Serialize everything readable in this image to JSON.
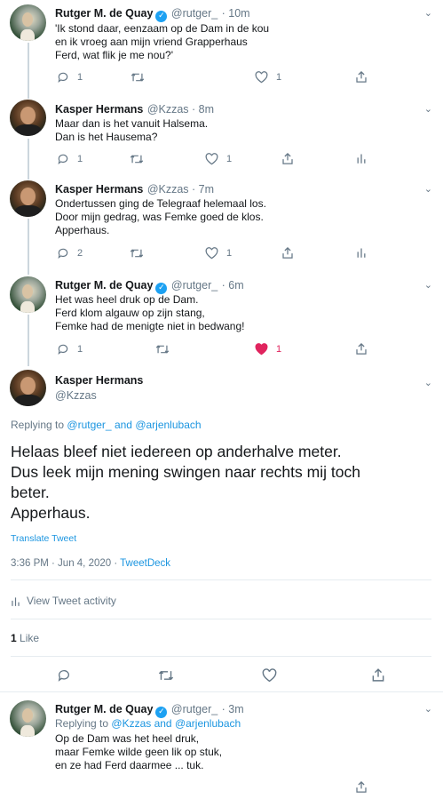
{
  "tweets": [
    {
      "name": "Rutger M. de Quay",
      "verified": true,
      "handle": "@rutger_",
      "time": "· 10m",
      "text": "'Ik stond daar, eenzaam op de Dam in de kou\nen ik vroeg aan mijn vriend Grapperhaus\nFerd, wat flik je me nou?'",
      "replies": "1",
      "retweets": "",
      "likes": "1",
      "avatar": "rutger"
    },
    {
      "name": "Kasper Hermans",
      "verified": false,
      "handle": "@Kzzas · 8m",
      "time": "",
      "text": "Maar dan is het vanuit Halsema.\nDan is het Hausema?",
      "replies": "1",
      "retweets": "",
      "likes": "1",
      "avatar": "kasper"
    },
    {
      "name": "Kasper Hermans",
      "verified": false,
      "handle": "@Kzzas · 7m",
      "time": "",
      "text": "Ondertussen ging de Telegraaf helemaal los.\nDoor mijn gedrag, was Femke goed de klos.\nApperhaus.",
      "replies": "2",
      "retweets": "",
      "likes": "1",
      "avatar": "kasper"
    },
    {
      "name": "Rutger M. de Quay",
      "verified": true,
      "handle": "@rutger_",
      "time": "· 6m",
      "text": "Het was heel druk op de Dam.\nFerd klom algauw op zijn stang,\nFemke had de menigte niet in bedwang!",
      "replies": "1",
      "retweets": "",
      "likes": "1",
      "avatar": "rutger"
    }
  ],
  "main_tweet": {
    "name": "Kasper Hermans",
    "handle": "@Kzzas",
    "replying_prefix": "Replying to",
    "replying_user1": "@rutger_",
    "replying_and": "and",
    "replying_user2": "@arjenlubach",
    "text": "Helaas bleef niet iedereen op anderhalve meter.\nDus leek mijn mening swingen naar rechts mij toch\nbeter.\nApperhaus.",
    "translate": "Translate Tweet",
    "timestamp": "3:36 PM · Jun 4, 2020 · ",
    "client": "TweetDeck",
    "activity": "View Tweet activity",
    "likes_count": "1",
    "likes_label": "Like"
  },
  "reply": {
    "name": "Rutger M. de Quay",
    "handle": "@rutger_",
    "time": "· 3m",
    "replying_prefix": "Replying to",
    "replying_users": "@Kzzas and @arjenlubach",
    "text": "Op de Dam was het heel druk,\nmaar Femke wilde geen lik op stuk,\nen ze had Ferd daarmee ... tuk."
  },
  "colors": {
    "link": "#1b95e0",
    "liked": "#e0245e",
    "verified": "#1da1f2",
    "secondary_text": "#657786"
  },
  "icons": [
    "reply-icon",
    "retweet-icon",
    "like-icon",
    "share-icon",
    "analytics-icon",
    "chevron-down-icon",
    "verified-badge-icon"
  ]
}
